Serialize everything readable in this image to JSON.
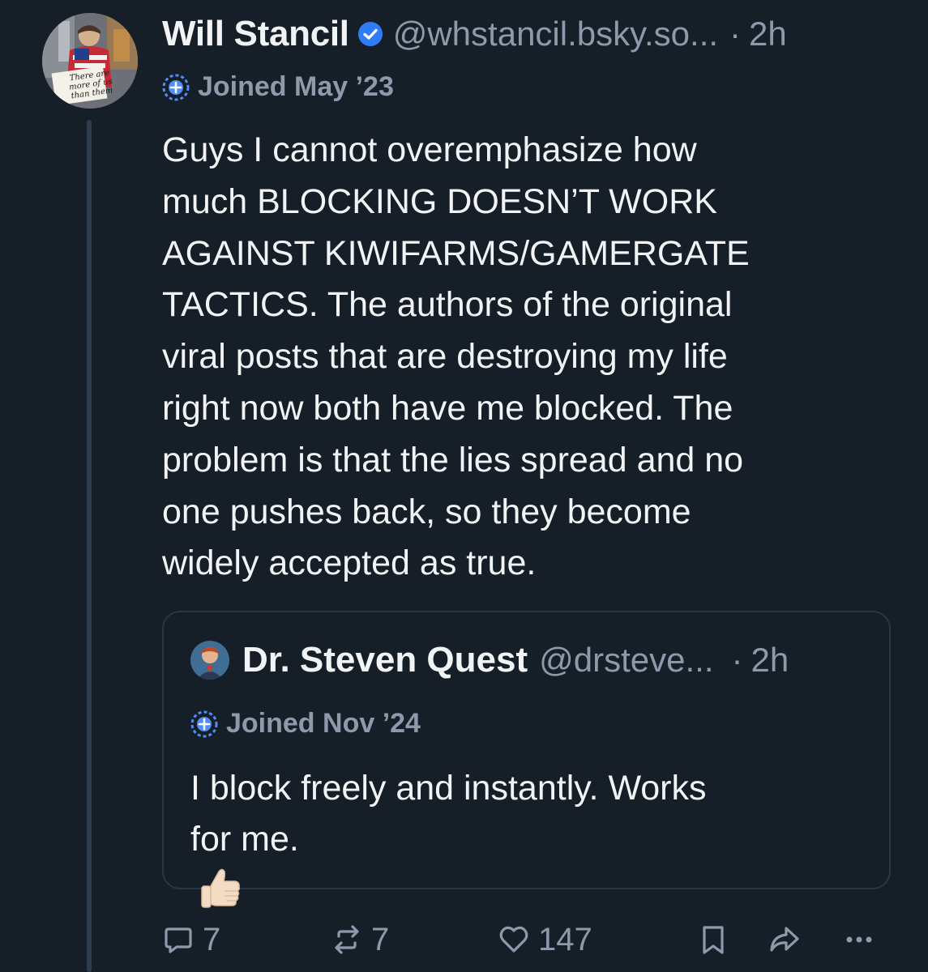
{
  "post": {
    "author": {
      "display_name": "Will Stancil",
      "handle": "@whstancil.bsky.so...",
      "separator": "·",
      "time": "2h",
      "joined": "Joined May ’23",
      "avatar_sign": [
        "There are",
        "more of us",
        "than them"
      ]
    },
    "body_lines": [
      "Guys I cannot overemphasize how",
      "much BLOCKING DOESN’T WORK",
      "AGAINST KIWIFARMS/GAMERGATE",
      "TACTICS. The authors of the original",
      "viral posts that are destroying my life",
      "right now both have me blocked. The",
      "problem is that the lies spread and no",
      "one pushes back, so they become",
      "widely accepted as true."
    ],
    "quote": {
      "display_name": "Dr. Steven Quest",
      "handle": "@drsteve...",
      "separator": "·",
      "time": "2h",
      "joined": "Joined Nov ’24",
      "text_lines": [
        "I block freely and instantly. Works",
        "for me."
      ]
    },
    "actions": {
      "replies": "7",
      "reposts": "7",
      "likes": "147"
    },
    "colors": {
      "background": "#161e27",
      "primary_text": "#f1f3f5",
      "secondary_text": "#8d9aab",
      "verified_blue": "#2f7df6",
      "border": "#2a3644"
    }
  }
}
